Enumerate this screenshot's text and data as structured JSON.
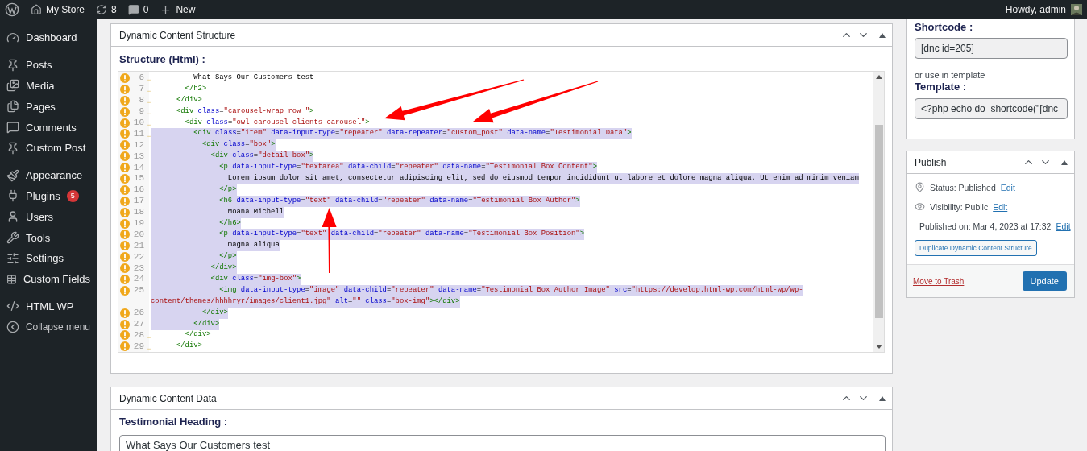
{
  "admin_bar": {
    "site": "My Store",
    "updates": "8",
    "comments": "0",
    "new": "New",
    "greeting": "Howdy, admin"
  },
  "sidebar": {
    "groups": [
      [
        {
          "label": "Dashboard"
        }
      ],
      [
        {
          "label": "Posts"
        },
        {
          "label": "Media"
        },
        {
          "label": "Pages"
        },
        {
          "label": "Comments"
        },
        {
          "label": "Custom Post"
        }
      ],
      [
        {
          "label": "Appearance"
        },
        {
          "label": "Plugins",
          "badge": "5"
        },
        {
          "label": "Users"
        },
        {
          "label": "Tools"
        },
        {
          "label": "Settings"
        },
        {
          "label": "Custom Fields"
        }
      ],
      [
        {
          "label": "HTML WP"
        },
        {
          "label": "Collapse menu"
        }
      ]
    ]
  },
  "structure_box": {
    "title": "Dynamic Content Structure",
    "label": "Structure (Html) :",
    "lines": [
      {
        "number": "6",
        "text": "          What Says Our Customers test",
        "selected": false,
        "marked": true
      },
      {
        "number": "7",
        "text": "        </h2>",
        "selected": false,
        "marked": true
      },
      {
        "number": "8",
        "text": "      </div>",
        "selected": false,
        "marked": true
      },
      {
        "number": "9",
        "text": "      <div class=\"carousel-wrap row \">",
        "selected": false,
        "marked": true
      },
      {
        "number": "10",
        "text": "        <div class=\"owl-carousel clients-carousel\">",
        "selected": false,
        "marked": true
      },
      {
        "number": "11",
        "text": "          <div class=\"item\" data-input-type=\"repeater\" data-repeater=\"custom_post\" data-name=\"Testimonial Data\">",
        "selected": true,
        "marked": true
      },
      {
        "number": "12",
        "text": "            <div class=\"box\">",
        "selected": true,
        "marked": false
      },
      {
        "number": "13",
        "text": "              <div class=\"detail-box\">",
        "selected": true,
        "marked": false
      },
      {
        "number": "14",
        "text": "                <p data-input-type=\"textarea\" data-child=\"repeater\" data-name=\"Testimonial Box Content\">",
        "selected": true,
        "marked": false
      },
      {
        "number": "15",
        "text": "                  Lorem ipsum dolor sit amet, consectetur adipiscing elit, sed do eiusmod tempor incididunt ut labore et dolore magna aliqua. Ut enim ad minim veniam",
        "selected": true,
        "marked": false
      },
      {
        "number": "16",
        "text": "                </p>",
        "selected": true,
        "marked": false
      },
      {
        "number": "17",
        "text": "                <h6 data-input-type=\"text\" data-child=\"repeater\" data-name=\"Testimonial Box Author\">",
        "selected": true,
        "marked": false
      },
      {
        "number": "18",
        "text": "                  Moana Michell",
        "selected": true,
        "marked": false
      },
      {
        "number": "19",
        "text": "                </h6>",
        "selected": true,
        "marked": false
      },
      {
        "number": "20",
        "text": "                <p data-input-type=\"text\" data-child=\"repeater\" data-name=\"Testimonial Box Position\">",
        "selected": true,
        "marked": false
      },
      {
        "number": "21",
        "text": "                  magna aliqua",
        "selected": true,
        "marked": false
      },
      {
        "number": "22",
        "text": "                </p>",
        "selected": true,
        "marked": false
      },
      {
        "number": "23",
        "text": "              </div>",
        "selected": true,
        "marked": false
      },
      {
        "number": "24",
        "text": "              <div class=\"img-box\">",
        "selected": true,
        "marked": false
      },
      {
        "number": "25",
        "text": "                <img data-input-type=\"image\" data-child=\"repeater\" data-name=\"Testimonial Box Author Image\" src=\"https://develop.html-wp.com/html-wp/wp-",
        "wrap": "content/themes/hhhhryr/images/client1.jpg\" alt=\"\" class=\"box-img\"></div>",
        "selected": true,
        "marked": false
      },
      {
        "number": "26",
        "text": "            </div>",
        "selected": true,
        "marked": false
      },
      {
        "number": "27",
        "text": "          </div>",
        "selected": true,
        "marked": false
      },
      {
        "number": "28",
        "text": "        </div>",
        "selected": false,
        "marked": true
      },
      {
        "number": "29",
        "text": "      </div>",
        "selected": false,
        "marked": true
      }
    ]
  },
  "data_box": {
    "title": "Dynamic Content Data",
    "field_label": "Testimonial Heading :",
    "field_value": "What Says Our Customers test"
  },
  "shortcode_box": {
    "label": "Shortcode :",
    "shortcode": "[dnc id=205]",
    "hint": "or use in template",
    "template_label": "Template :",
    "template": "<?php echo do_shortcode(\"[dnc"
  },
  "publish_box": {
    "title": "Publish",
    "rows": [
      {
        "text": "Status: Published",
        "link": "Edit"
      },
      {
        "text": "Visibility: Public",
        "link": "Edit"
      },
      {
        "text": "Published on: Mar 4, 2023 at 17:32",
        "link": "Edit"
      }
    ],
    "duplicate_button": "Duplicate Dynamic Content Structure",
    "trash_link": "Move to Trash",
    "update_button": "Update"
  }
}
